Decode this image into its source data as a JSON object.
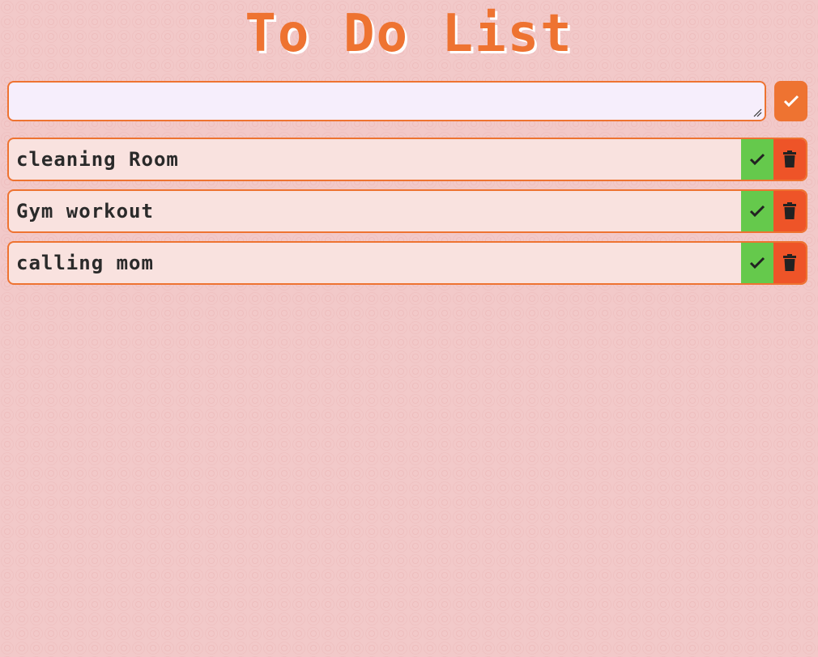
{
  "header": {
    "title": "To Do List"
  },
  "new_task": {
    "value": "",
    "add_icon": "check-icon"
  },
  "todos": [
    {
      "text": "cleaning Room",
      "complete_icon": "check-icon",
      "delete_icon": "trash-icon"
    },
    {
      "text": "Gym workout",
      "complete_icon": "check-icon",
      "delete_icon": "trash-icon"
    },
    {
      "text": "calling mom",
      "complete_icon": "check-icon",
      "delete_icon": "trash-icon"
    }
  ],
  "colors": {
    "accent": "#ee7331",
    "complete": "#65c94c",
    "delete": "#ee5428",
    "background": "#f2c9c9",
    "item_background": "#f9e2df",
    "input_background": "#f6eefc"
  }
}
